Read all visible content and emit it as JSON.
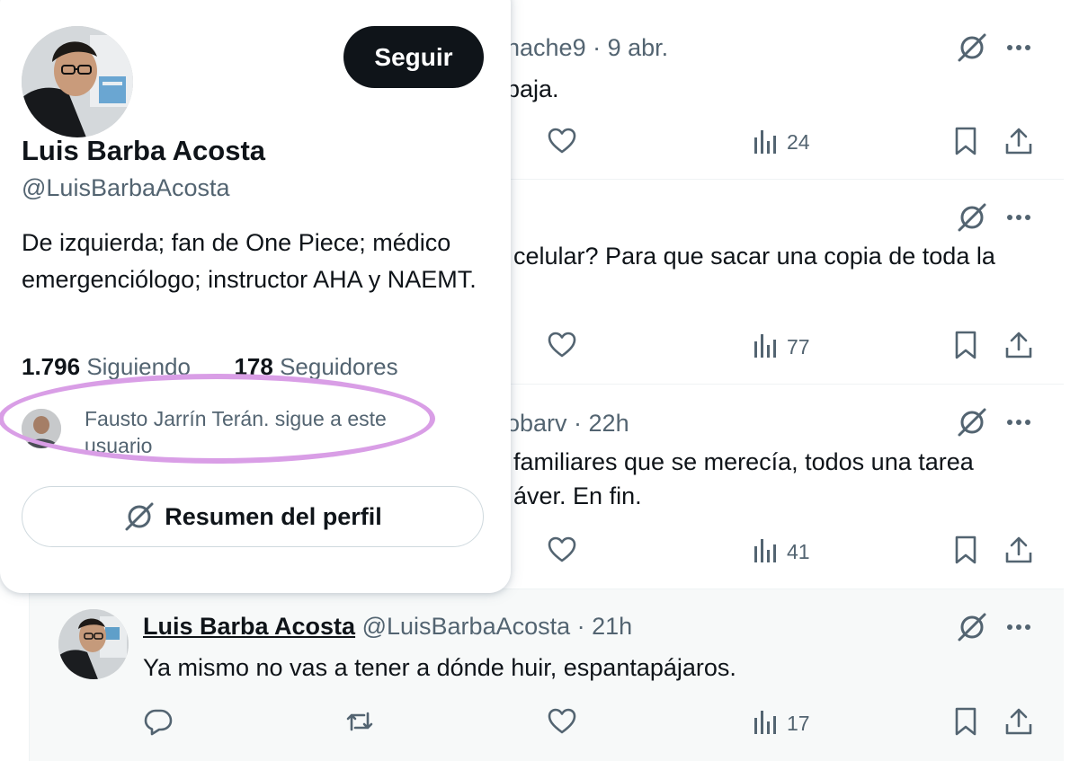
{
  "tweets": [
    {
      "header": "nache9 · 9 abr.",
      "text": "paja.",
      "views": "24"
    },
    {
      "header": "",
      "text": "celular? Para que sacar una copia de toda la",
      "views": "77"
    },
    {
      "header": "obarv · 22h",
      "text_lines": [
        "familiares que se merecía, todos una tarea",
        "áver. En fin."
      ],
      "views": "41"
    }
  ],
  "reply": {
    "name": "Luis Barba Acosta",
    "meta": "@LuisBarbaAcosta · 21h",
    "text": "Ya mismo no vas a tener a dónde huir, espantapájaros.",
    "views": "17"
  },
  "card": {
    "follow_label": "Seguir",
    "name": "Luis Barba Acosta",
    "handle": "@LuisBarbaAcosta",
    "bio": "De izquierda; fan de One Piece; médico emergenciólogo; instructor AHA y NAEMT.",
    "following_count": "1.796",
    "following_label": "Siguiendo",
    "followers_count": "178",
    "followers_label": "Seguidores",
    "followed_by": "Fausto Jarrín Terán. sigue a este usuario",
    "summary_label": "Resumen del perfil"
  },
  "icons": [
    "grok-icon",
    "more-icon",
    "like-icon",
    "views-icon",
    "bookmark-icon",
    "share-icon",
    "reply-icon",
    "retweet-icon"
  ],
  "colors": {
    "text": "#0f1419",
    "secondary": "#536471",
    "highlight_bg": "#f7f9f9",
    "annotation": "#d99ee6",
    "button_dark": "#0f1419"
  }
}
